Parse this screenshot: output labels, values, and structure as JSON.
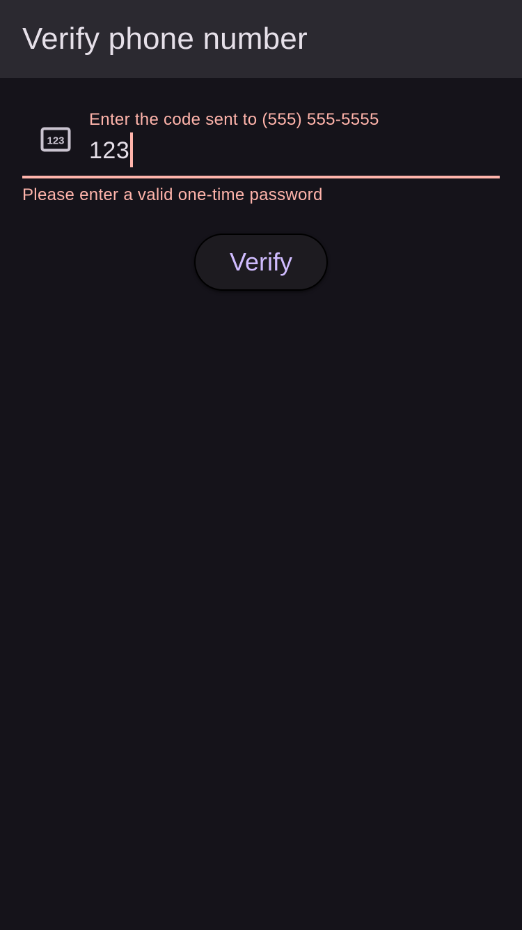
{
  "app_bar": {
    "title": "Verify phone number"
  },
  "code_field": {
    "icon": "dialpad-123-icon",
    "label": "Enter the code sent to (555) 555-5555",
    "value": "123",
    "error": "Please enter a valid one-time password"
  },
  "actions": {
    "verify_label": "Verify"
  },
  "colors": {
    "background": "#15131a",
    "app_bar": "#2b2930",
    "error": "#ffb4ab",
    "primary": "#d0bcff",
    "on_surface": "#e6e0e9"
  }
}
